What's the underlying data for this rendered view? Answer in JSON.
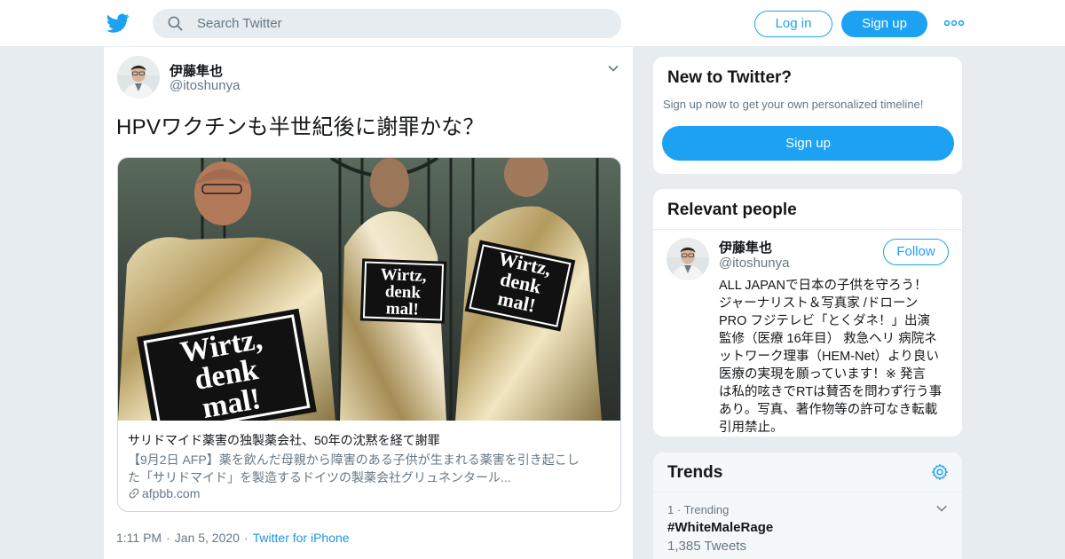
{
  "header": {
    "search_placeholder": "Search Twitter",
    "login_label": "Log in",
    "signup_label": "Sign up"
  },
  "tweet": {
    "author_name": "伊藤隼也",
    "author_handle": "@itoshunya",
    "text": "HPVワクチンも半世紀後に謝罪かな？",
    "card": {
      "image_signs": [
        "Wirtz,",
        "denk",
        "mal!"
      ],
      "title": "サリドマイド薬害の独製薬会社、50年の沈黙を経て謝罪",
      "description_line1": "【9月2日 AFP】薬を飲んだ母親から障害のある子供が生まれる薬害を引き起こし",
      "description_line2": "た「サリドマイド」を製造するドイツの製薬会社グリュネンタール...",
      "domain": "afpbb.com"
    },
    "time": "1:11 PM",
    "date": "Jan 5, 2020",
    "client": "Twitter for iPhone",
    "separator": "·"
  },
  "sidebar": {
    "new_to_twitter": {
      "title": "New to Twitter?",
      "subtitle": "Sign up now to get your own personalized timeline!",
      "button_label": "Sign up"
    },
    "relevant_people": {
      "title": "Relevant people",
      "name": "伊藤隼也",
      "handle": "@itoshunya",
      "follow_label": "Follow",
      "bio_lines": [
        "ALL JAPANで日本の子供を守ろう！",
        "ジャーナリスト＆写真家 /ドローン",
        "PRO フジテレビ「とくダネ！」出演",
        "監修（医療 16年目） 救急ヘリ 病院ネ",
        "ットワーク理事（HEM-Net）より良い",
        "医療の実現を願っています！※ 発言",
        "は私的呟きでRTは賛否を問わず行う事",
        "あり。写真、著作物等の許可なき転載",
        "引用禁止。"
      ]
    },
    "trends": {
      "title": "Trends",
      "items": [
        {
          "rank": "1",
          "label": "Trending",
          "tag": "#WhiteMaleRage",
          "count": "1,385 Tweets"
        }
      ]
    }
  },
  "colors": {
    "accent": "#1da1f2",
    "background": "#e6ecf0",
    "secondary_text": "#657786"
  }
}
